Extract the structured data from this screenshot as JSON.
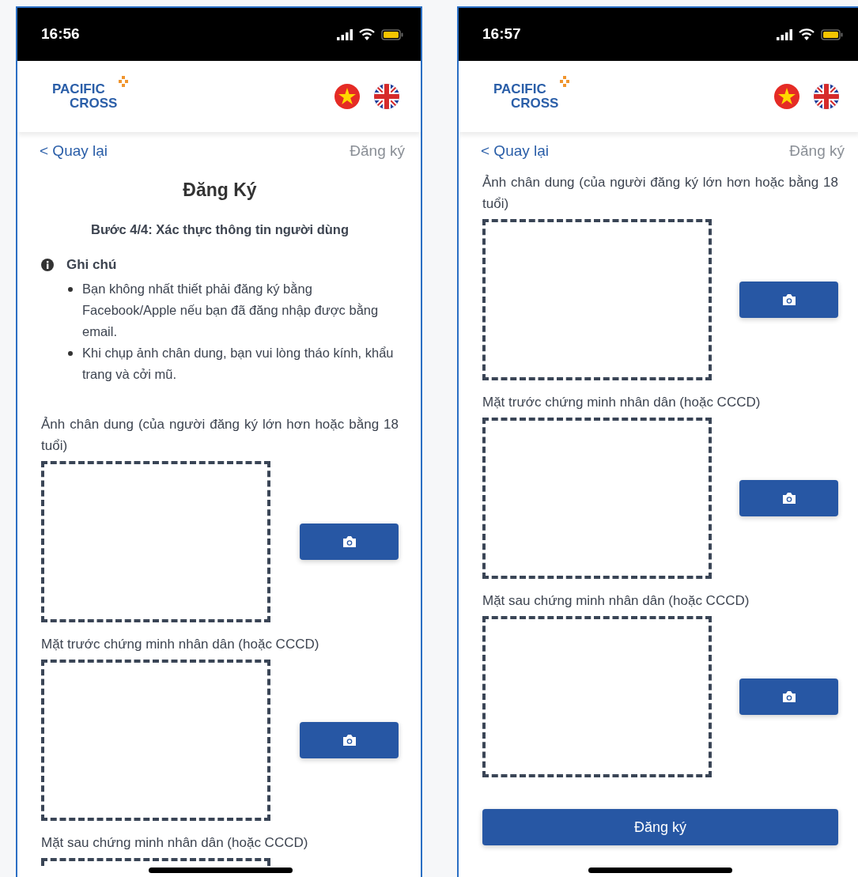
{
  "screens": [
    {
      "status_bar": {
        "time": "16:56"
      },
      "header": {
        "logo_lines": [
          "PACIFIC",
          "CROSS"
        ]
      },
      "nav": {
        "back": "< Quay lại",
        "title": "Đăng ký"
      },
      "page_title": "Đăng Ký",
      "step": "Bước 4/4: Xác thực thông tin người dùng",
      "note": {
        "heading": "Ghi chú",
        "items": [
          "Bạn không nhất thiết phải đăng ký bằng Facebook/Apple nếu bạn đã đăng nhập được bằng email.",
          "Khi chụp ảnh chân dung, bạn vui lòng tháo kính, khẩu trang và cởi mũ."
        ]
      },
      "photo_fields": [
        {
          "label": "Ảnh chân dung (của người đăng ký lớn hơn hoặc bằng 18 tuổi)",
          "cut_off": false
        },
        {
          "label": "Mặt trước chứng minh nhân dân (hoặc CCCD)",
          "cut_off": false
        },
        {
          "label": "Mặt sau chứng minh nhân dân (hoặc CCCD)",
          "cut_off": true
        }
      ]
    },
    {
      "status_bar": {
        "time": "16:57"
      },
      "header": {
        "logo_lines": [
          "PACIFIC",
          "CROSS"
        ]
      },
      "nav": {
        "back": "< Quay lại",
        "title": "Đăng ký"
      },
      "photo_fields": [
        {
          "label": "Ảnh chân dung (của người đăng ký lớn hơn hoặc bằng 18 tuổi)",
          "cut_off": false
        },
        {
          "label": "Mặt trước chứng minh nhân dân (hoặc CCCD)",
          "cut_off": false
        },
        {
          "label": "Mặt sau chứng minh nhân dân (hoặc CCCD)",
          "cut_off": false
        }
      ],
      "submit_button": "Đăng ký"
    }
  ]
}
